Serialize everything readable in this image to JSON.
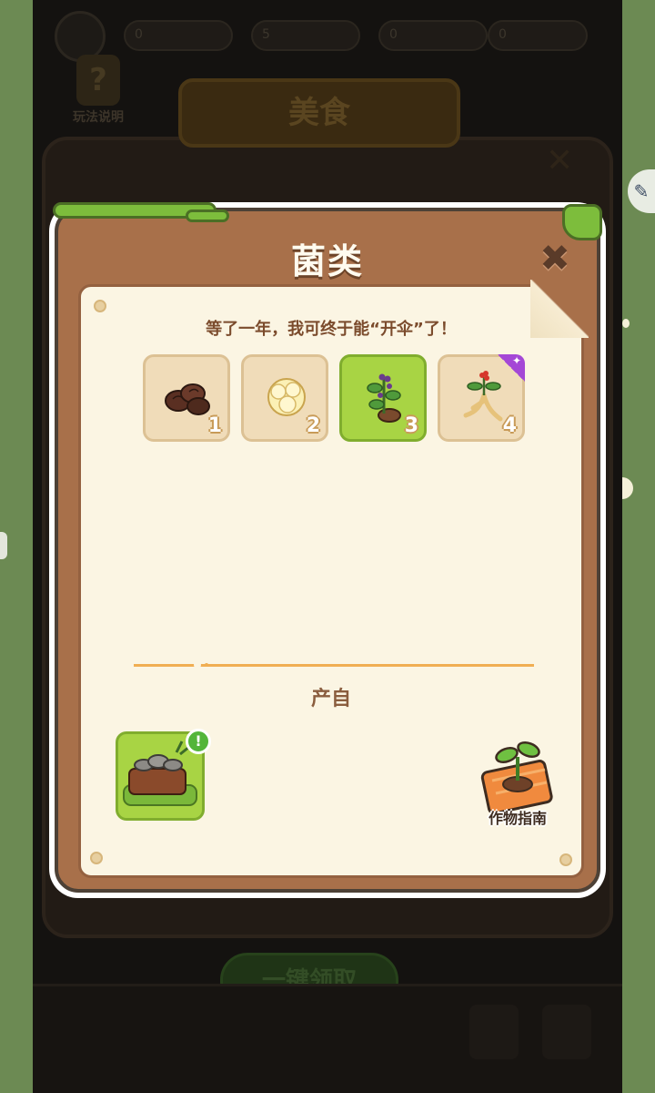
{
  "background": {
    "help_label": "玩法说明",
    "banner_title": "美食",
    "claim_all_button": "一键领取",
    "top_values": [
      "0",
      "5",
      "0",
      "0"
    ]
  },
  "modal": {
    "title": "菌类",
    "quote": "等了一年，我可终于能“开伞”了！",
    "items": [
      {
        "level": "1",
        "name_icon": "wood-ear-fungus-icon",
        "selected": false
      },
      {
        "level": "2",
        "name_icon": "white-fungus-icon",
        "selected": false
      },
      {
        "level": "3",
        "name_icon": "berry-root-plant-icon",
        "selected": true
      },
      {
        "level": "4",
        "name_icon": "ginseng-icon",
        "selected": false,
        "rare": true
      }
    ],
    "source_label": "产自",
    "source_alert": "!",
    "crop_guide_label": "作物指南"
  },
  "colors": {
    "frame_brown": "#a8704a",
    "paper": "#fbf5e3",
    "selected_green": "#a8d444",
    "accent_orange": "#f0ae53"
  }
}
